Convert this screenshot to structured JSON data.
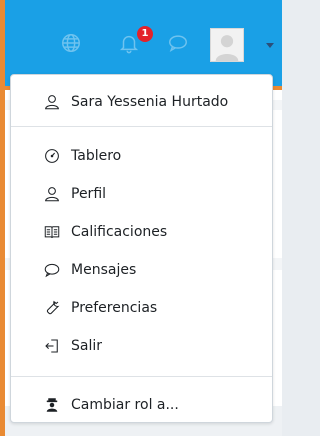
{
  "topbar": {
    "notification_count": "1",
    "icons": [
      "globe-icon",
      "bell-icon",
      "chat-icon",
      "avatar",
      "caret-down-icon"
    ]
  },
  "menu": {
    "user_name": "Sara Yessenia Hurtado",
    "items": [
      {
        "label": "Tablero",
        "icon": "dashboard-icon"
      },
      {
        "label": "Perfil",
        "icon": "user-icon"
      },
      {
        "label": "Calificaciones",
        "icon": "grades-icon"
      },
      {
        "label": "Mensajes",
        "icon": "chat-icon"
      },
      {
        "label": "Preferencias",
        "icon": "wrench-icon"
      },
      {
        "label": "Salir",
        "icon": "logout-icon"
      }
    ],
    "switch_role": {
      "label": "Cambiar rol a...",
      "icon": "role-icon"
    }
  },
  "colors": {
    "topbar": "#1aa0e6",
    "accent": "#e98a33",
    "badge": "#e3222b"
  }
}
